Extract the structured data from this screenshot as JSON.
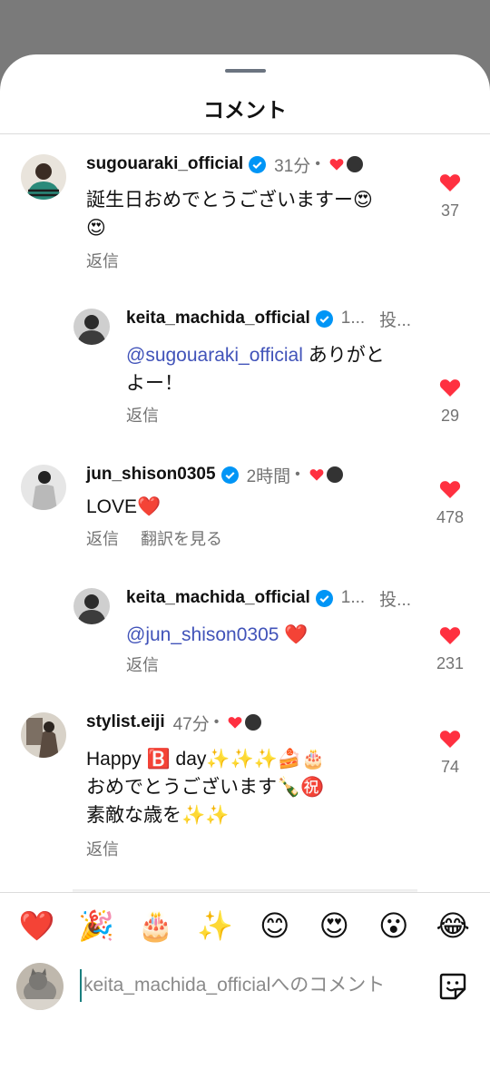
{
  "sheet": {
    "title": "コメント"
  },
  "comments": [
    {
      "username": "sugouaraki_official",
      "time": "31分",
      "text_line1": "誕生日おめでとうございますー😍",
      "text_line2": "😍",
      "reply_label": "返信",
      "likes": "37"
    },
    {
      "username": "keita_machida_official",
      "time": "1...",
      "posted": "投...",
      "mention": "@sugouaraki_official",
      "text_after": " ありがと",
      "text_line2": "よー！",
      "reply_label": "返信",
      "likes": "29"
    },
    {
      "username": "jun_shison0305",
      "time": "2時間",
      "text": "LOVE",
      "text_emoji": "❤️",
      "reply_label": "返信",
      "translate_label": "翻訳を見る",
      "likes": "478"
    },
    {
      "username": "keita_machida_official",
      "time": "1...",
      "posted": "投...",
      "mention": "@jun_shison0305",
      "text_emoji": " ❤️",
      "reply_label": "返信",
      "likes": "231"
    },
    {
      "username": "stylist.eiji",
      "time": "47分",
      "text_line1": "Happy 🅱️ day✨✨✨🍰🎂",
      "text_line2": "おめでとうございます🍾㊗️",
      "text_line3": "素敵な歳を✨✨",
      "reply_label": "返信",
      "likes": "74"
    }
  ],
  "reactions": [
    "❤️",
    "🎉",
    "🎂",
    "✨",
    "😊",
    "😍",
    "😮",
    "😂"
  ],
  "composer": {
    "placeholder": "keita_machida_officialへのコメント"
  },
  "colors": {
    "accent_like": "#ff3040",
    "verified": "#0095f6",
    "mention": "#4153b9",
    "muted": "#737373"
  },
  "icons": [
    "verified-badge-icon",
    "heart-icon",
    "sticker-icon"
  ]
}
